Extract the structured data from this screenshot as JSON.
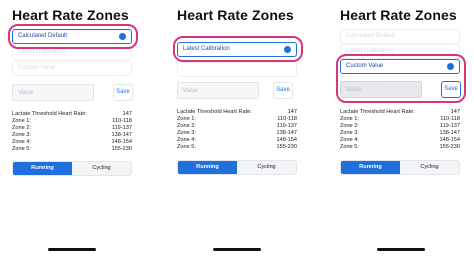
{
  "screens": [
    {
      "title": "Heart Rate Zones",
      "options": [
        {
          "label": "Calculated Default"
        },
        {
          "label": "Latest Calibration"
        },
        {
          "label": "Custom Value"
        }
      ],
      "value_placeholder": "Value",
      "save_label": "Save",
      "zones": [
        {
          "label": "Lactate Threshold Heart Rate:",
          "value": "147"
        },
        {
          "label": "Zone 1:",
          "value": "110-118"
        },
        {
          "label": "Zone 2:",
          "value": "119-137"
        },
        {
          "label": "Zone 3:",
          "value": "138-147"
        },
        {
          "label": "Zone 4:",
          "value": "148-154"
        },
        {
          "label": "Zone 5:",
          "value": "155-230"
        }
      ],
      "segments": [
        "Running",
        "Cycling"
      ],
      "selected_option": "Calculated Default",
      "selected_segment": "Running"
    },
    {
      "title": "Heart Rate Zones",
      "options": [
        {
          "label": "Latest Calibration"
        }
      ],
      "value_placeholder": "Value",
      "save_label": "Save",
      "zones": [
        {
          "label": "Lactate Threshold Heart Rate:",
          "value": "147"
        },
        {
          "label": "Zone 1:",
          "value": "110-118"
        },
        {
          "label": "Zone 2:",
          "value": "119-137"
        },
        {
          "label": "Zone 3:",
          "value": "138-147"
        },
        {
          "label": "Zone 4:",
          "value": "148-154"
        },
        {
          "label": "Zone 5:",
          "value": "155-230"
        }
      ],
      "segments": [
        "Running",
        "Cycling"
      ],
      "selected_option": "Latest Calibration",
      "selected_segment": "Running"
    },
    {
      "title": "Heart Rate Zones",
      "options": [
        {
          "label": "Calculated Default"
        },
        {
          "label": "Latest Calibration"
        },
        {
          "label": "Custom Value"
        }
      ],
      "value_placeholder": "Value",
      "save_label": "Save",
      "zones": [
        {
          "label": "Lactate Threshold Heart Rate:",
          "value": "147"
        },
        {
          "label": "Zone 1:",
          "value": "110-118"
        },
        {
          "label": "Zone 2:",
          "value": "119-137"
        },
        {
          "label": "Zone 3:",
          "value": "138-147"
        },
        {
          "label": "Zone 4:",
          "value": "148-154"
        },
        {
          "label": "Zone 5:",
          "value": "155-230"
        }
      ],
      "segments": [
        "Running",
        "Cycling"
      ],
      "selected_option": "Custom Value",
      "selected_segment": "Running"
    }
  ],
  "colors": {
    "accent": "#1f6fde",
    "highlight": "#d6367a"
  }
}
